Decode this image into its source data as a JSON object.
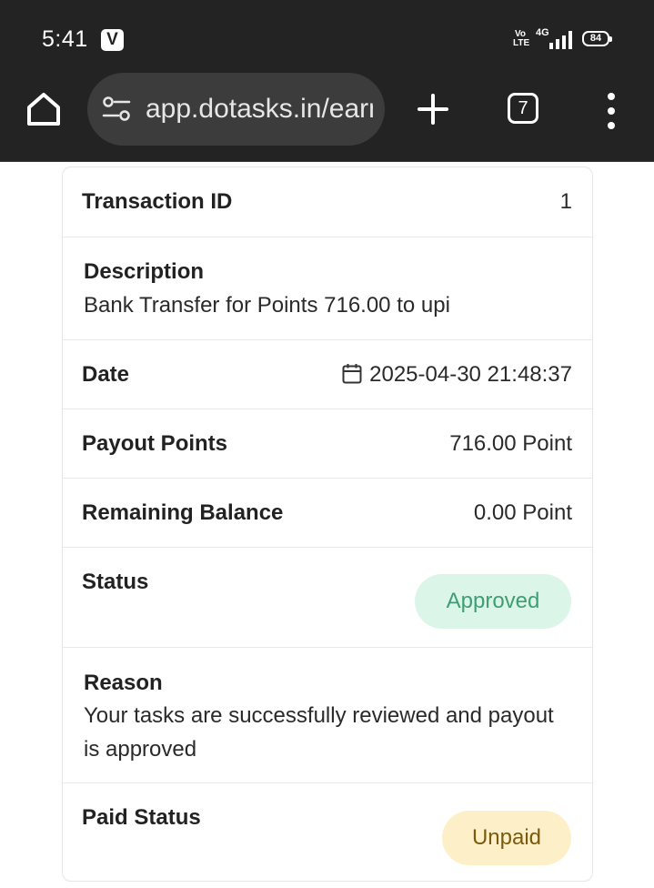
{
  "status_bar": {
    "time": "5:41",
    "app_badge": "V",
    "volte_text": "Vo LTE",
    "network": "4G",
    "battery": "84"
  },
  "browser": {
    "url": "app.dotasks.in/earn",
    "tab_count": "7",
    "icons": [
      "home-icon",
      "site-settings-icon",
      "plus-icon",
      "tab-switcher-icon",
      "more-vert-icon"
    ]
  },
  "transaction": {
    "id_label": "Transaction ID",
    "id_value": "1",
    "description_label": "Description",
    "description_value": "Bank Transfer for Points 716.00 to upi",
    "date_label": "Date",
    "date_value": "2025-04-30 21:48:37",
    "payout_label": "Payout Points",
    "payout_value": "716.00 Point",
    "balance_label": "Remaining Balance",
    "balance_value": "0.00 Point",
    "status_label": "Status",
    "status_value": "Approved",
    "reason_label": "Reason",
    "reason_value": "Your tasks are successfully reviewed and payout is approved",
    "paid_status_label": "Paid Status",
    "paid_status_value": "Unpaid"
  },
  "colors": {
    "chrome_bg": "#232323",
    "urlbar_bg": "#3c3c3c",
    "approved_bg": "#dcf5e9",
    "approved_text": "#3f9e73",
    "unpaid_bg": "#fdf0c8",
    "unpaid_text": "#7a5a0e"
  }
}
